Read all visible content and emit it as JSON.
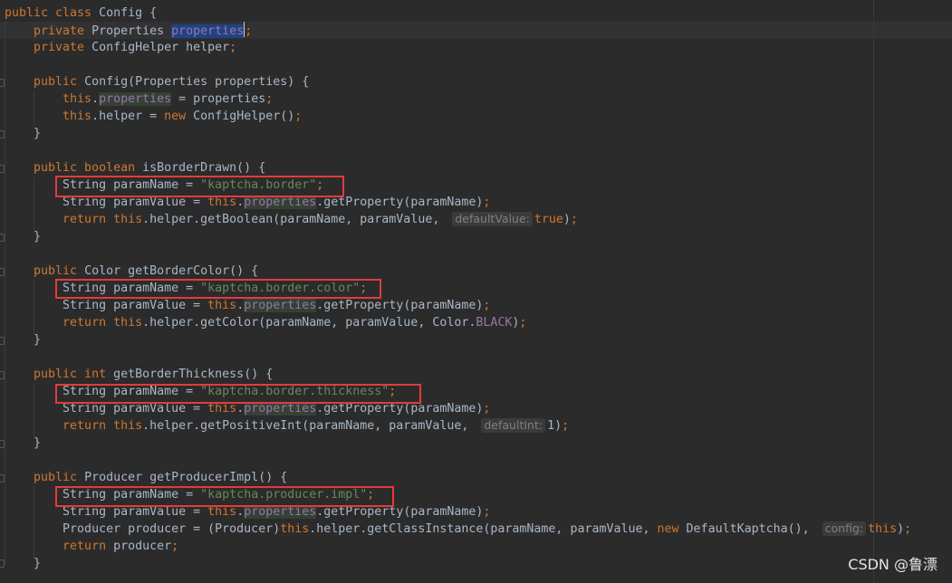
{
  "editor": {
    "lines": [
      [
        [
          "kw",
          "public class "
        ],
        [
          "pb",
          "Config {"
        ]
      ],
      [
        [
          "kw",
          "    private "
        ],
        [
          "pb",
          "Properties "
        ],
        [
          "sel",
          "properties"
        ],
        [
          "caret",
          ""
        ],
        [
          "kw",
          ";"
        ]
      ],
      [
        [
          "kw",
          "    private "
        ],
        [
          "pb",
          "ConfigHelper helper"
        ],
        [
          "kw",
          ";"
        ]
      ],
      [],
      [
        [
          "kw",
          "    public "
        ],
        [
          "pb",
          "Config(Properties properties) {"
        ]
      ],
      [
        [
          "kw",
          "        this"
        ],
        [
          "pb",
          "."
        ],
        [
          "read",
          "properties"
        ],
        [
          "pb",
          " = properties"
        ],
        [
          "kw",
          ";"
        ]
      ],
      [
        [
          "kw",
          "        this"
        ],
        [
          "pb",
          ".helper = "
        ],
        [
          "kw",
          "new "
        ],
        [
          "pb",
          "ConfigHelper()"
        ],
        [
          "kw",
          ";"
        ]
      ],
      [
        [
          "pb",
          "    }"
        ]
      ],
      [],
      [
        [
          "kw",
          "    public boolean "
        ],
        [
          "pb",
          "isBorderDrawn() {"
        ]
      ],
      [
        [
          "pb",
          "        String paramName = "
        ],
        [
          "str",
          "\"kaptcha.border\""
        ],
        [
          "kw",
          ";"
        ]
      ],
      [
        [
          "pb",
          "        String paramValue = "
        ],
        [
          "kw",
          "this"
        ],
        [
          "pb",
          "."
        ],
        [
          "read",
          "properties"
        ],
        [
          "pb",
          ".getProperty(paramName)"
        ],
        [
          "kw",
          ";"
        ]
      ],
      [
        [
          "kw",
          "        return this"
        ],
        [
          "pb",
          ".helper.getBoolean(paramName, paramValue, "
        ],
        [
          "hint",
          "defaultValue:"
        ],
        [
          "kw",
          "true"
        ],
        [
          "pb",
          ")"
        ],
        [
          "kw",
          ";"
        ]
      ],
      [
        [
          "pb",
          "    }"
        ]
      ],
      [],
      [
        [
          "kw",
          "    public "
        ],
        [
          "pb",
          "Color getBorderColor() {"
        ]
      ],
      [
        [
          "pb",
          "        String paramName = "
        ],
        [
          "str",
          "\"kaptcha.border.color\""
        ],
        [
          "kw",
          ";"
        ]
      ],
      [
        [
          "pb",
          "        String paramValue = "
        ],
        [
          "kw",
          "this"
        ],
        [
          "pb",
          "."
        ],
        [
          "read",
          "properties"
        ],
        [
          "pb",
          ".getProperty(paramName)"
        ],
        [
          "kw",
          ";"
        ]
      ],
      [
        [
          "kw",
          "        return this"
        ],
        [
          "pb",
          ".helper.getColor(paramName, paramValue, Color."
        ],
        [
          "fld",
          "BLACK"
        ],
        [
          "pb",
          ")"
        ],
        [
          "kw",
          ";"
        ]
      ],
      [
        [
          "pb",
          "    }"
        ]
      ],
      [],
      [
        [
          "kw",
          "    public int "
        ],
        [
          "pb",
          "getBorderThickness() {"
        ]
      ],
      [
        [
          "pb",
          "        String paramName = "
        ],
        [
          "str",
          "\"kaptcha.border.thickness\""
        ],
        [
          "kw",
          ";"
        ]
      ],
      [
        [
          "pb",
          "        String paramValue = "
        ],
        [
          "kw",
          "this"
        ],
        [
          "pb",
          "."
        ],
        [
          "read",
          "properties"
        ],
        [
          "pb",
          ".getProperty(paramName)"
        ],
        [
          "kw",
          ";"
        ]
      ],
      [
        [
          "kw",
          "        return this"
        ],
        [
          "pb",
          ".helper.getPositiveInt(paramName, paramValue, "
        ],
        [
          "hint",
          "defaultInt:"
        ],
        [
          "pb",
          "1)"
        ],
        [
          "kw",
          ";"
        ]
      ],
      [
        [
          "pb",
          "    }"
        ]
      ],
      [],
      [
        [
          "kw",
          "    public "
        ],
        [
          "pb",
          "Producer getProducerImpl() {"
        ]
      ],
      [
        [
          "pb",
          "        String paramName = "
        ],
        [
          "str",
          "\"kaptcha.producer.impl\""
        ],
        [
          "kw",
          ";"
        ]
      ],
      [
        [
          "pb",
          "        String paramValue = "
        ],
        [
          "kw",
          "this"
        ],
        [
          "pb",
          "."
        ],
        [
          "read",
          "properties"
        ],
        [
          "pb",
          ".getProperty(paramName)"
        ],
        [
          "kw",
          ";"
        ]
      ],
      [
        [
          "pb",
          "        Producer producer = (Producer)"
        ],
        [
          "kw",
          "this"
        ],
        [
          "pb",
          ".helper.getClassInstance(paramName, paramValue, "
        ],
        [
          "kw",
          "new "
        ],
        [
          "pb",
          "DefaultKaptcha(), "
        ],
        [
          "hint",
          "config:"
        ],
        [
          "kw",
          "this"
        ],
        [
          "pb",
          ")"
        ],
        [
          "kw",
          ";"
        ]
      ],
      [
        [
          "kw",
          "        return "
        ],
        [
          "pb",
          "producer"
        ],
        [
          "kw",
          ";"
        ]
      ],
      [
        [
          "pb",
          "    }"
        ]
      ]
    ]
  },
  "colors": {
    "background": "#2b2b2b",
    "keyword": "#cc7832",
    "string": "#6a8759",
    "default_text": "#a9b7c6",
    "highlight_box": "#e33b3b"
  },
  "watermark": "CSDN @鲁漂"
}
